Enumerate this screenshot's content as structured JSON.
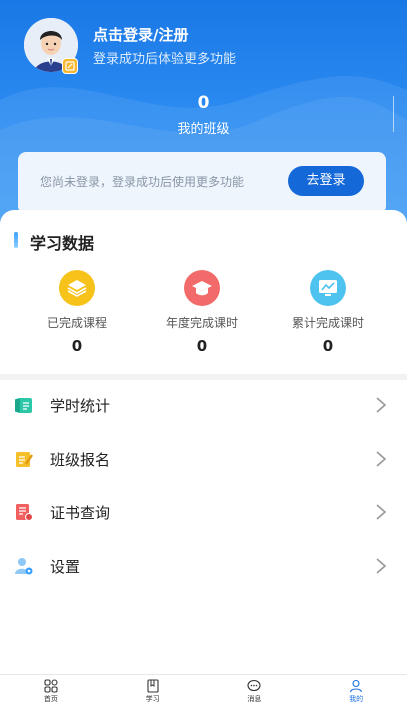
{
  "profile": {
    "title": "点击登录/注册",
    "subtitle": "登录成功后体验更多功能"
  },
  "class_stat": {
    "count": "0",
    "label": "我的班级"
  },
  "login_card": {
    "message": "您尚未登录，登录成功后使用更多功能",
    "button_label": "去登录"
  },
  "study_data": {
    "title": "学习数据",
    "items": [
      {
        "label": "已完成课程",
        "value": "0",
        "icon": "stack-icon",
        "color": "#f7c21a"
      },
      {
        "label": "年度完成课时",
        "value": "0",
        "icon": "graduation-cap-icon",
        "color": "#f26a6a"
      },
      {
        "label": "累计完成课时",
        "value": "0",
        "icon": "monitor-icon",
        "color": "#4fc3f0"
      }
    ]
  },
  "menu": {
    "items": [
      {
        "label": "学时统计",
        "icon": "book-stats-icon",
        "color": "#2cc7a8"
      },
      {
        "label": "班级报名",
        "icon": "edit-doc-icon",
        "color": "#f5c02a"
      },
      {
        "label": "证书查询",
        "icon": "certificate-icon",
        "color": "#f06060"
      },
      {
        "label": "设置",
        "icon": "user-settings-icon",
        "color": "#3aa0ff"
      }
    ]
  },
  "tabbar": {
    "items": [
      {
        "label": "首页",
        "icon": "grid-icon"
      },
      {
        "label": "学习",
        "icon": "book-icon"
      },
      {
        "label": "消息",
        "icon": "chat-icon"
      },
      {
        "label": "我的",
        "icon": "person-icon"
      }
    ],
    "active_color": "#1d6fe0"
  },
  "colors": {
    "primary": "#1468d8",
    "header": "#1a78e6"
  }
}
